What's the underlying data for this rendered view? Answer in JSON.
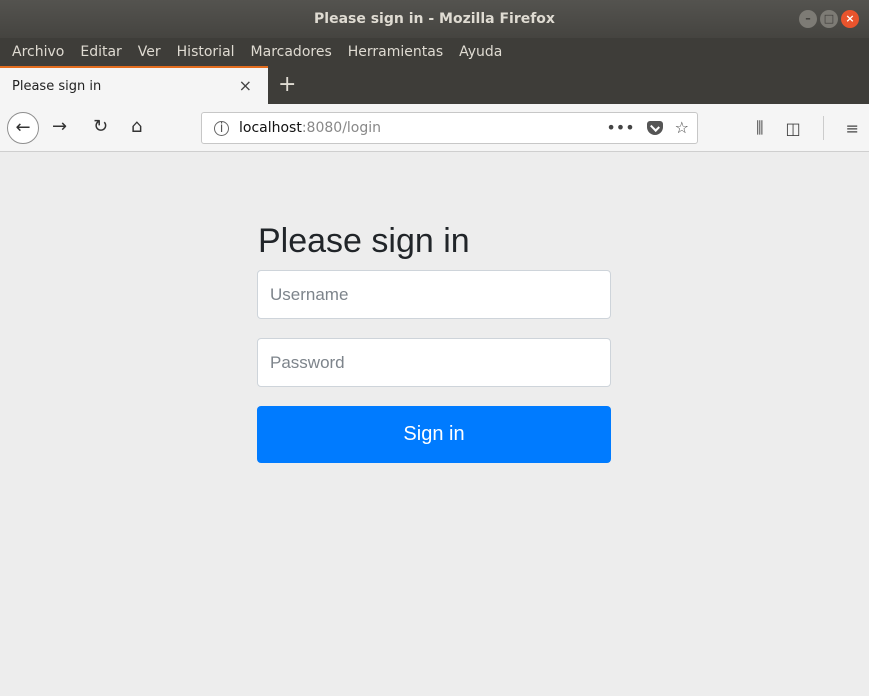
{
  "window": {
    "title": "Please sign in - Mozilla Firefox"
  },
  "menu": [
    "Archivo",
    "Editar",
    "Ver",
    "Historial",
    "Marcadores",
    "Herramientas",
    "Ayuda"
  ],
  "tab": {
    "label": "Please sign in",
    "close": "×",
    "new": "+"
  },
  "nav": {
    "host": "localhost",
    "path": ":8080/login"
  },
  "page": {
    "heading": "Please sign in",
    "username_placeholder": "Username",
    "password_placeholder": "Password",
    "button_label": "Sign in"
  },
  "colors": {
    "accent": "#007bff",
    "tab_highlight": "#e26c1e"
  }
}
